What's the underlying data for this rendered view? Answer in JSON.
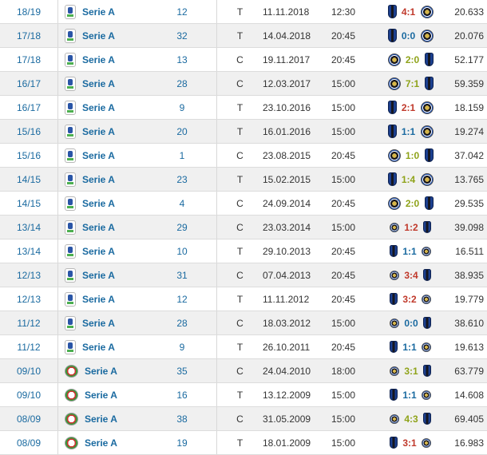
{
  "colors": {
    "link": "#1a6aa0",
    "win": "#c0392b",
    "draw": "#1a6aa0",
    "loss": "#8fa31a",
    "row_alt": "#f0f0f0"
  },
  "rows": [
    {
      "season": "18/19",
      "competition": "Serie A",
      "logo": "serie-a-logo",
      "round": "12",
      "venue": "T",
      "date": "11.11.2018",
      "time": "12:30",
      "home": "atalanta-crest",
      "score": "4:1",
      "result": "win",
      "away": "inter-crest",
      "attendance": "20.633",
      "size": "large"
    },
    {
      "season": "17/18",
      "competition": "Serie A",
      "logo": "serie-a-logo",
      "round": "32",
      "venue": "T",
      "date": "14.04.2018",
      "time": "20:45",
      "home": "atalanta-crest",
      "score": "0:0",
      "result": "draw",
      "away": "inter-crest",
      "attendance": "20.076",
      "size": "large"
    },
    {
      "season": "17/18",
      "competition": "Serie A",
      "logo": "serie-a-logo",
      "round": "13",
      "venue": "C",
      "date": "19.11.2017",
      "time": "20:45",
      "home": "inter-crest",
      "score": "2:0",
      "result": "loss",
      "away": "atalanta-crest",
      "attendance": "52.177",
      "size": "large"
    },
    {
      "season": "16/17",
      "competition": "Serie A",
      "logo": "serie-a-logo",
      "round": "28",
      "venue": "C",
      "date": "12.03.2017",
      "time": "15:00",
      "home": "inter-crest",
      "score": "7:1",
      "result": "loss",
      "away": "atalanta-crest",
      "attendance": "59.359",
      "size": "large"
    },
    {
      "season": "16/17",
      "competition": "Serie A",
      "logo": "serie-a-logo",
      "round": "9",
      "venue": "T",
      "date": "23.10.2016",
      "time": "15:00",
      "home": "atalanta-crest",
      "score": "2:1",
      "result": "win",
      "away": "inter-crest",
      "attendance": "18.159",
      "size": "large"
    },
    {
      "season": "15/16",
      "competition": "Serie A",
      "logo": "serie-a-logo",
      "round": "20",
      "venue": "T",
      "date": "16.01.2016",
      "time": "15:00",
      "home": "atalanta-crest",
      "score": "1:1",
      "result": "draw",
      "away": "inter-crest",
      "attendance": "19.274",
      "size": "large"
    },
    {
      "season": "15/16",
      "competition": "Serie A",
      "logo": "serie-a-logo",
      "round": "1",
      "venue": "C",
      "date": "23.08.2015",
      "time": "20:45",
      "home": "inter-crest",
      "score": "1:0",
      "result": "loss",
      "away": "atalanta-crest",
      "attendance": "37.042",
      "size": "large"
    },
    {
      "season": "14/15",
      "competition": "Serie A",
      "logo": "serie-a-logo",
      "round": "23",
      "venue": "T",
      "date": "15.02.2015",
      "time": "15:00",
      "home": "atalanta-crest",
      "score": "1:4",
      "result": "loss",
      "away": "inter-crest",
      "attendance": "13.765",
      "size": "large"
    },
    {
      "season": "14/15",
      "competition": "Serie A",
      "logo": "serie-a-logo",
      "round": "4",
      "venue": "C",
      "date": "24.09.2014",
      "time": "20:45",
      "home": "inter-crest",
      "score": "2:0",
      "result": "loss",
      "away": "atalanta-crest",
      "attendance": "29.535",
      "size": "large"
    },
    {
      "season": "13/14",
      "competition": "Serie A",
      "logo": "serie-a-logo",
      "round": "29",
      "venue": "C",
      "date": "23.03.2014",
      "time": "15:00",
      "home": "inter-crest",
      "score": "1:2",
      "result": "win",
      "away": "atalanta-crest",
      "attendance": "39.098",
      "size": "small"
    },
    {
      "season": "13/14",
      "competition": "Serie A",
      "logo": "serie-a-logo",
      "round": "10",
      "venue": "T",
      "date": "29.10.2013",
      "time": "20:45",
      "home": "atalanta-crest",
      "score": "1:1",
      "result": "draw",
      "away": "inter-crest",
      "attendance": "16.511",
      "size": "small"
    },
    {
      "season": "12/13",
      "competition": "Serie A",
      "logo": "serie-a-logo",
      "round": "31",
      "venue": "C",
      "date": "07.04.2013",
      "time": "20:45",
      "home": "inter-crest",
      "score": "3:4",
      "result": "win",
      "away": "atalanta-crest",
      "attendance": "38.935",
      "size": "small"
    },
    {
      "season": "12/13",
      "competition": "Serie A",
      "logo": "serie-a-logo",
      "round": "12",
      "venue": "T",
      "date": "11.11.2012",
      "time": "20:45",
      "home": "atalanta-crest",
      "score": "3:2",
      "result": "win",
      "away": "inter-crest",
      "attendance": "19.779",
      "size": "small"
    },
    {
      "season": "11/12",
      "competition": "Serie A",
      "logo": "serie-a-logo",
      "round": "28",
      "venue": "C",
      "date": "18.03.2012",
      "time": "15:00",
      "home": "inter-crest",
      "score": "0:0",
      "result": "draw",
      "away": "atalanta-crest",
      "attendance": "38.610",
      "size": "small"
    },
    {
      "season": "11/12",
      "competition": "Serie A",
      "logo": "serie-a-logo",
      "round": "9",
      "venue": "T",
      "date": "26.10.2011",
      "time": "20:45",
      "home": "atalanta-crest",
      "score": "1:1",
      "result": "draw",
      "away": "inter-crest",
      "attendance": "19.613",
      "size": "small"
    },
    {
      "season": "09/10",
      "competition": "Serie A",
      "logo": "serie-a-old-logo",
      "round": "35",
      "venue": "C",
      "date": "24.04.2010",
      "time": "18:00",
      "home": "inter-crest",
      "score": "3:1",
      "result": "loss",
      "away": "atalanta-crest",
      "attendance": "63.779",
      "size": "small"
    },
    {
      "season": "09/10",
      "competition": "Serie A",
      "logo": "serie-a-old-logo",
      "round": "16",
      "venue": "T",
      "date": "13.12.2009",
      "time": "15:00",
      "home": "atalanta-crest",
      "score": "1:1",
      "result": "draw",
      "away": "inter-crest",
      "attendance": "14.608",
      "size": "small"
    },
    {
      "season": "08/09",
      "competition": "Serie A",
      "logo": "serie-a-old-logo",
      "round": "38",
      "venue": "C",
      "date": "31.05.2009",
      "time": "15:00",
      "home": "inter-crest",
      "score": "4:3",
      "result": "loss",
      "away": "atalanta-crest",
      "attendance": "69.405",
      "size": "small"
    },
    {
      "season": "08/09",
      "competition": "Serie A",
      "logo": "serie-a-old-logo",
      "round": "19",
      "venue": "T",
      "date": "18.01.2009",
      "time": "15:00",
      "home": "atalanta-crest",
      "score": "3:1",
      "result": "win",
      "away": "inter-crest",
      "attendance": "16.983",
      "size": "small"
    }
  ]
}
